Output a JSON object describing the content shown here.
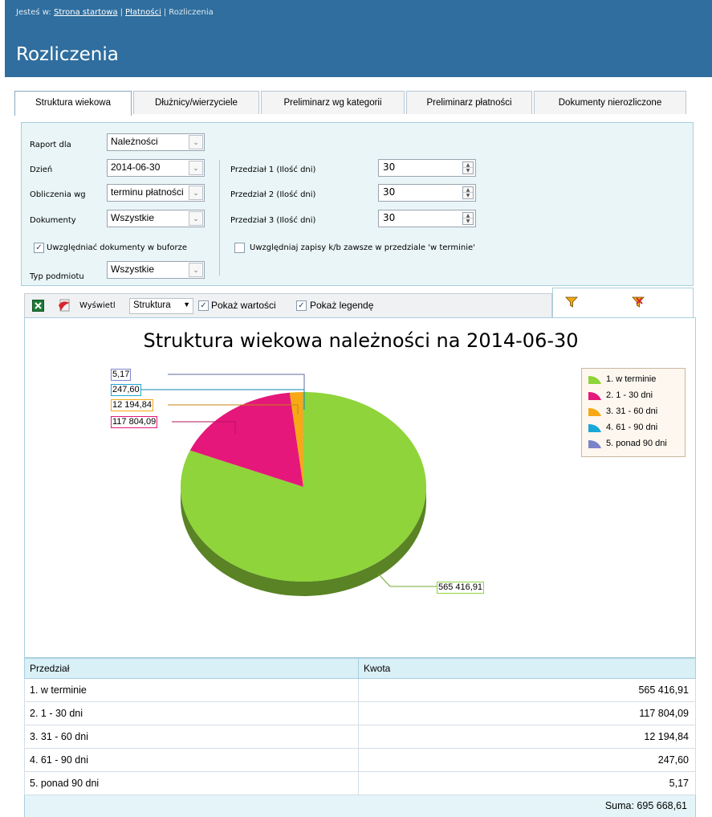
{
  "breadcrumb": {
    "prefix": "Jesteś w:",
    "items": [
      "Strona startowa",
      "Płatności"
    ],
    "current": "Rozliczenia"
  },
  "page_title": "Rozliczenia",
  "tabs": [
    {
      "label": "Struktura wiekowa",
      "active": true
    },
    {
      "label": "Dłużnicy/wierzyciele",
      "active": false
    },
    {
      "label": "Preliminarz wg kategorii",
      "active": false
    },
    {
      "label": "Preliminarz płatności",
      "active": false
    },
    {
      "label": "Dokumenty nierozliczone",
      "active": false
    }
  ],
  "filters": {
    "raport_label": "Raport dla",
    "raport_value": "Należności",
    "dzien_label": "Dzień",
    "dzien_value": "2014-06-30",
    "obliczenia_label": "Obliczenia wg",
    "obliczenia_value": "terminu płatności",
    "dokumenty_label": "Dokumenty",
    "dokumenty_value": "Wszystkie",
    "uwzgledniac_label": "Uwzględniać dokumenty w buforze",
    "uwzgledniac_checked": true,
    "typ_label": "Typ podmiotu",
    "typ_value": "Wszystkie",
    "przedzial1_label": "Przedział 1 (Ilość dni)",
    "przedzial1_value": "30",
    "przedzial2_label": "Przedział 2 (Ilość dni)",
    "przedzial2_value": "30",
    "przedzial3_label": "Przedział 3 (Ilość dni)",
    "przedzial3_value": "30",
    "zapisy_label": "Uwzględniaj zapisy k/b zawsze w przedziale 'w terminie'",
    "zapisy_checked": false
  },
  "toolbar": {
    "wyswietl_label": "Wyświetl",
    "wyswietl_value": "Struktura",
    "pokaz_wartosci_label": "Pokaż wartości",
    "pokaz_wartosci_checked": true,
    "pokaz_legende_label": "Pokaż legendę",
    "pokaz_legende_checked": true
  },
  "chart_data": {
    "type": "pie",
    "title": "Struktura wiekowa należności na 2014-06-30",
    "legend_position": "top-right",
    "slices": [
      {
        "name": "1. w terminie",
        "value": 565416.91,
        "label": "565 416,91",
        "color": "#8fd43a"
      },
      {
        "name": "2.  1 - 30 dni",
        "value": 117804.09,
        "label": "117 804,09",
        "color": "#e5177a"
      },
      {
        "name": "3.  31 - 60 dni",
        "value": 12194.84,
        "label": "12 194,84",
        "color": "#f7a814"
      },
      {
        "name": "4.  61 - 90 dni",
        "value": 247.6,
        "label": "247,60",
        "color": "#1ba6d8"
      },
      {
        "name": "5. ponad 90 dni",
        "value": 5.17,
        "label": "5,17",
        "color": "#7a84c8"
      }
    ]
  },
  "table": {
    "headers": [
      "Przedział",
      "Kwota"
    ],
    "rows": [
      [
        "1. w terminie",
        "565 416,91"
      ],
      [
        "2. 1 - 30 dni",
        "117 804,09"
      ],
      [
        "3. 31 - 60 dni",
        "12 194,84"
      ],
      [
        "4. 61 - 90 dni",
        "247,60"
      ],
      [
        "5. ponad 90 dni",
        "5,17"
      ]
    ],
    "sum": "Suma: 695 668,61"
  }
}
